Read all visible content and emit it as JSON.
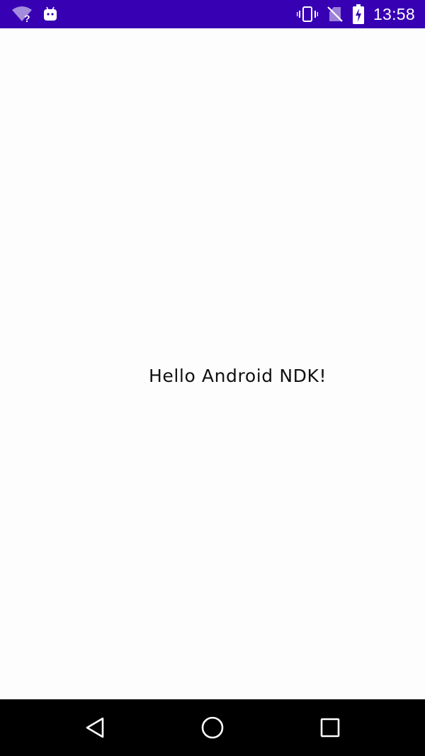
{
  "status_bar": {
    "time": "13:58",
    "background_color": "#3700b3",
    "left_icons": [
      "wifi-unknown-icon",
      "android-notification-icon"
    ],
    "right_icons": [
      "vibrate-icon",
      "no-sim-icon",
      "battery-charging-icon"
    ]
  },
  "main": {
    "text": "Hello Android NDK!"
  },
  "nav_bar": {
    "buttons": [
      "back-icon",
      "home-icon",
      "recents-icon"
    ]
  }
}
